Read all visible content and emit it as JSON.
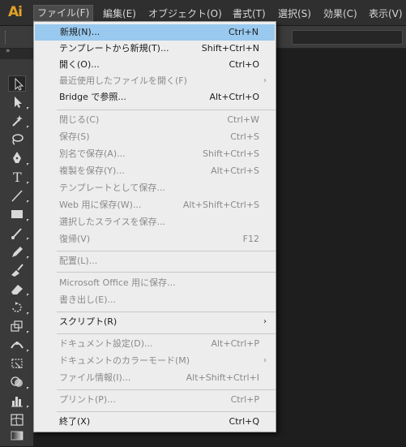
{
  "app": {
    "logo": "Ai"
  },
  "menubar": {
    "items": [
      {
        "label": "ファイル(F)"
      },
      {
        "label": "編集(E)"
      },
      {
        "label": "オブジェクト(O)"
      },
      {
        "label": "書式(T)"
      },
      {
        "label": "選択(S)"
      },
      {
        "label": "効果(C)"
      },
      {
        "label": "表示(V)"
      }
    ]
  },
  "toolpanel": {
    "collapse_glyph": "»"
  },
  "file_menu": {
    "highlight_color": "#99c9ef",
    "items": [
      {
        "label": "新規(N)...",
        "shortcut": "Ctrl+N",
        "enabled": true,
        "highlighted": true
      },
      {
        "label": "テンプレートから新規(T)...",
        "shortcut": "Shift+Ctrl+N",
        "enabled": true
      },
      {
        "label": "開く(O)...",
        "shortcut": "Ctrl+O",
        "enabled": true
      },
      {
        "label": "最近使用したファイルを開く(F)",
        "shortcut": "",
        "enabled": false,
        "submenu": true
      },
      {
        "label": "Bridge で参照...",
        "shortcut": "Alt+Ctrl+O",
        "enabled": true
      },
      {
        "label": "閉じる(C)",
        "shortcut": "Ctrl+W",
        "enabled": false
      },
      {
        "label": "保存(S)",
        "shortcut": "Ctrl+S",
        "enabled": false
      },
      {
        "label": "別名で保存(A)...",
        "shortcut": "Shift+Ctrl+S",
        "enabled": false
      },
      {
        "label": "複製を保存(Y)...",
        "shortcut": "Alt+Ctrl+S",
        "enabled": false
      },
      {
        "label": "テンプレートとして保存...",
        "shortcut": "",
        "enabled": false
      },
      {
        "label": "Web 用に保存(W)...",
        "shortcut": "Alt+Shift+Ctrl+S",
        "enabled": false
      },
      {
        "label": "選択したスライスを保存...",
        "shortcut": "",
        "enabled": false
      },
      {
        "label": "復帰(V)",
        "shortcut": "F12",
        "enabled": false
      },
      {
        "label": "配置(L)...",
        "shortcut": "",
        "enabled": false
      },
      {
        "label": "Microsoft Office 用に保存...",
        "shortcut": "",
        "enabled": false
      },
      {
        "label": "書き出し(E)...",
        "shortcut": "",
        "enabled": false
      },
      {
        "label": "スクリプト(R)",
        "shortcut": "",
        "enabled": true,
        "submenu": true
      },
      {
        "label": "ドキュメント設定(D)...",
        "shortcut": "Alt+Ctrl+P",
        "enabled": false
      },
      {
        "label": "ドキュメントのカラーモード(M)",
        "shortcut": "",
        "enabled": false,
        "submenu": true
      },
      {
        "label": "ファイル情報(I)...",
        "shortcut": "Alt+Shift+Ctrl+I",
        "enabled": false
      },
      {
        "label": "プリント(P)...",
        "shortcut": "Ctrl+P",
        "enabled": false
      },
      {
        "label": "終了(X)",
        "shortcut": "Ctrl+Q",
        "enabled": true
      }
    ]
  }
}
